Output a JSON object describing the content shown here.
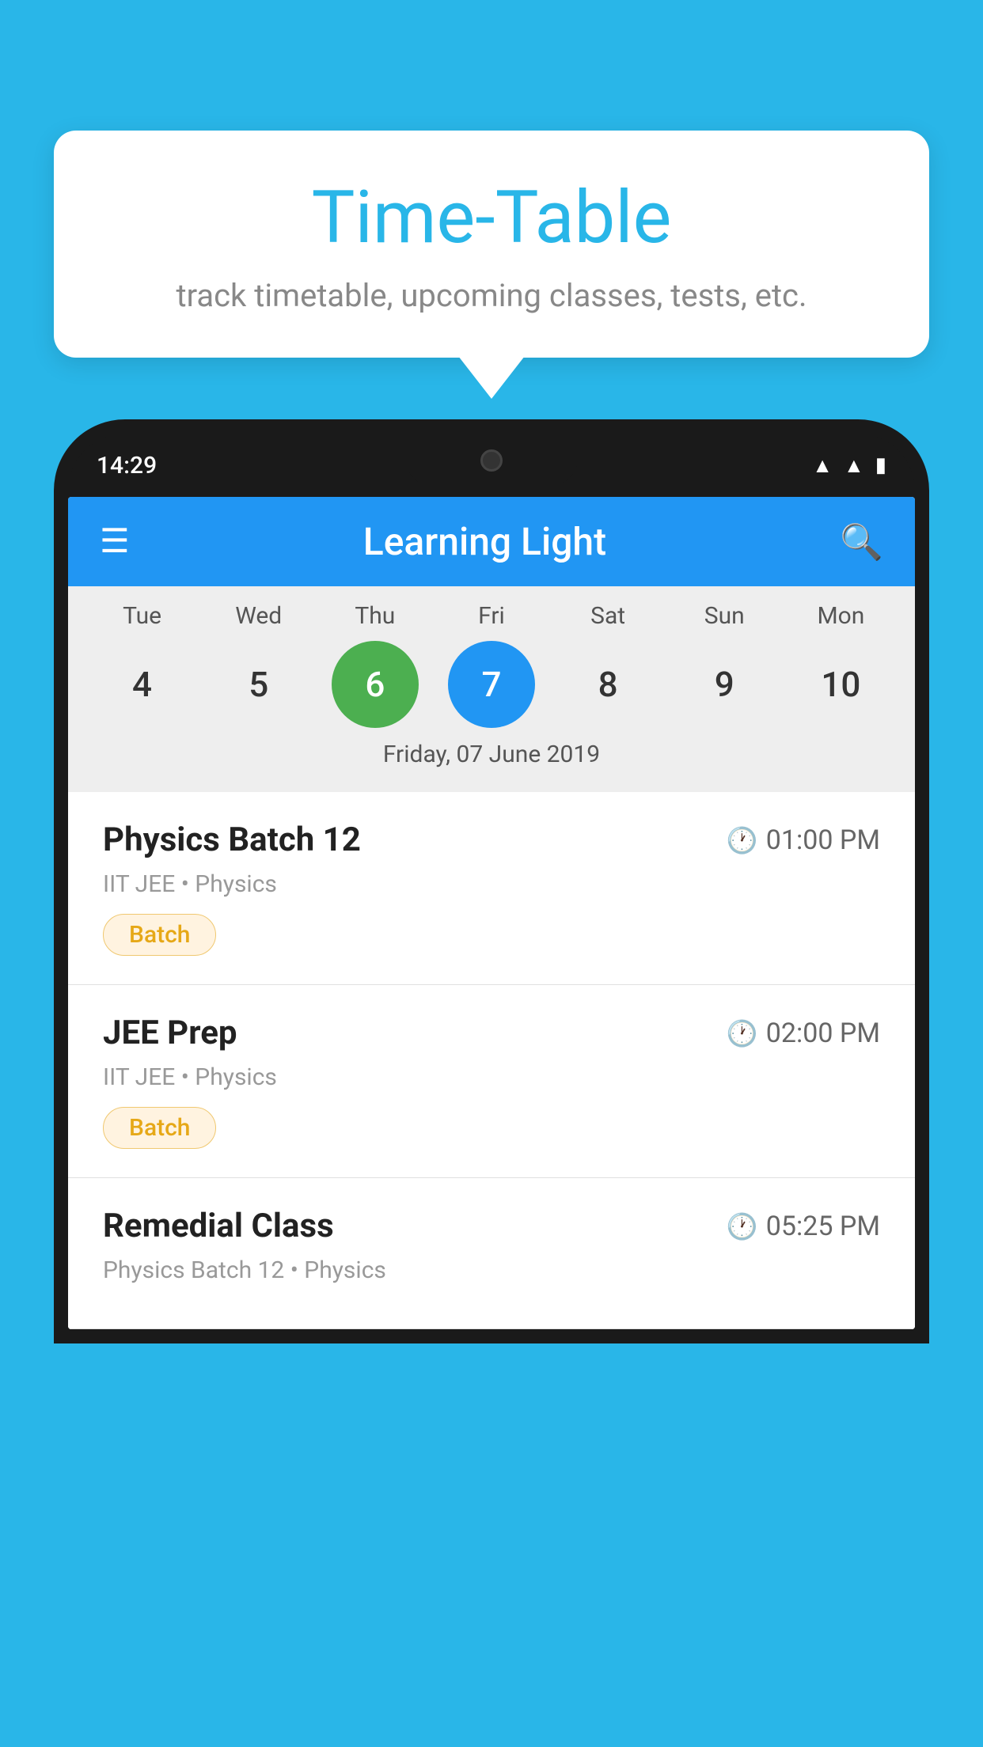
{
  "background_color": "#29b6e8",
  "tooltip": {
    "title": "Time-Table",
    "subtitle": "track timetable, upcoming classes, tests, etc."
  },
  "phone": {
    "status_bar": {
      "time": "14:29"
    },
    "app_bar": {
      "title": "Learning Light"
    },
    "calendar": {
      "days": [
        {
          "label": "Tue",
          "num": "4",
          "state": "normal"
        },
        {
          "label": "Wed",
          "num": "5",
          "state": "normal"
        },
        {
          "label": "Thu",
          "num": "6",
          "state": "today"
        },
        {
          "label": "Fri",
          "num": "7",
          "state": "selected"
        },
        {
          "label": "Sat",
          "num": "8",
          "state": "normal"
        },
        {
          "label": "Sun",
          "num": "9",
          "state": "normal"
        },
        {
          "label": "Mon",
          "num": "10",
          "state": "normal"
        }
      ],
      "selected_date_label": "Friday, 07 June 2019"
    },
    "classes": [
      {
        "name": "Physics Batch 12",
        "time": "01:00 PM",
        "meta": "IIT JEE • Physics",
        "badge": "Batch"
      },
      {
        "name": "JEE Prep",
        "time": "02:00 PM",
        "meta": "IIT JEE • Physics",
        "badge": "Batch"
      },
      {
        "name": "Remedial Class",
        "time": "05:25 PM",
        "meta": "Physics Batch 12 • Physics",
        "badge": null
      }
    ]
  }
}
